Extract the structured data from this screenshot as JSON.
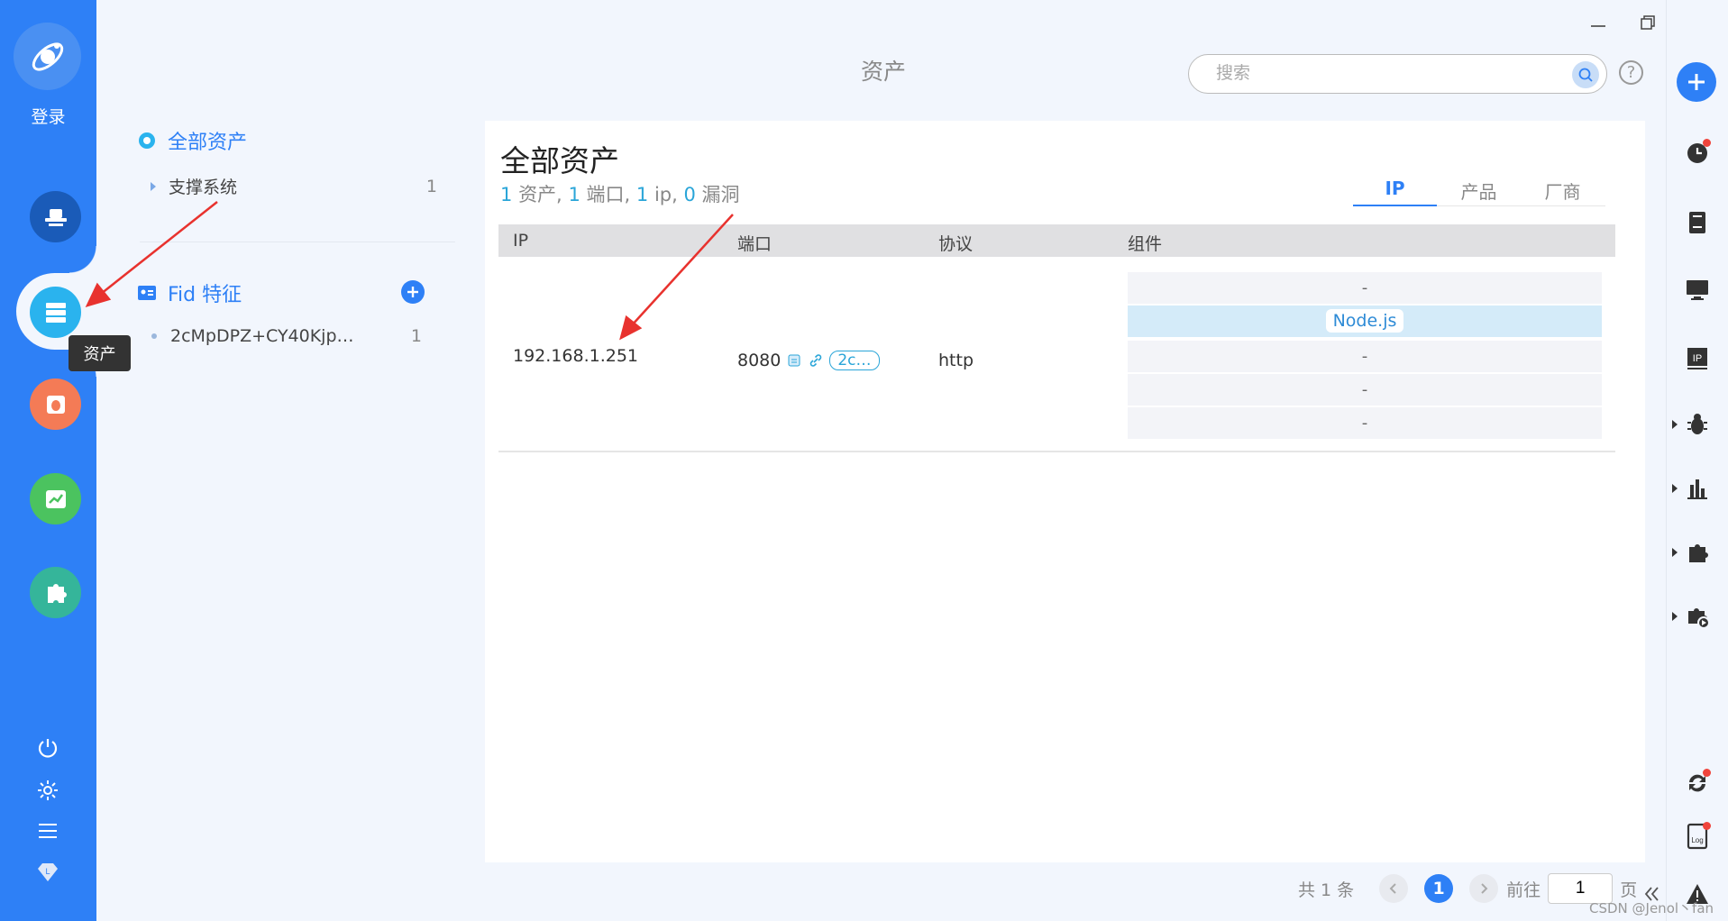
{
  "left_nav": {
    "login_label": "登录",
    "tooltip": "资产",
    "items": [
      {
        "icon": "hat-icon",
        "color": "#1a5bb8"
      },
      {
        "icon": "server-icon",
        "color": "#2ab3ee"
      },
      {
        "icon": "bug-icon",
        "color": "#f47b56"
      },
      {
        "icon": "chart-icon",
        "color": "#4bc35f"
      },
      {
        "icon": "puzzle-icon",
        "color": "#35b59a"
      }
    ],
    "bottom_icons": [
      "power-icon",
      "gear-icon",
      "menu-icon",
      "diamond-icon"
    ]
  },
  "header": {
    "title": "资产",
    "search_placeholder": "搜索",
    "help": "?"
  },
  "sidebar": {
    "all_assets": "全部资产",
    "support_system": {
      "label": "支撑系统",
      "count": "1"
    },
    "fid_title": "Fid 特征",
    "fid_item": {
      "label": "2cMpDPZ+CY40Kjp…",
      "count": "1"
    }
  },
  "main": {
    "title": "全部资产",
    "stats": {
      "assets_num": "1",
      "assets_label": "资产,",
      "ports_num": "1",
      "ports_label": "端口,",
      "ip_num": "1",
      "ip_label": "ip,",
      "vuln_num": "0",
      "vuln_label": "漏洞"
    },
    "tabs": [
      "IP",
      "产品",
      "厂商"
    ],
    "columns": [
      "IP",
      "端口",
      "协议",
      "组件"
    ],
    "row": {
      "ip": "192.168.1.251",
      "port": "8080",
      "fid_tag": "2c…",
      "protocol": "http",
      "components": [
        "-",
        "Node.js",
        "-",
        "-",
        "-"
      ]
    }
  },
  "pager": {
    "total": "共 1 条",
    "current": "1",
    "goto_label": "前往",
    "goto_value": "1",
    "page_suffix": "页"
  },
  "watermark": "CSDN @Jenol丶fan",
  "colors": {
    "primary": "#2e80f6",
    "annotation": "#e8322e"
  }
}
